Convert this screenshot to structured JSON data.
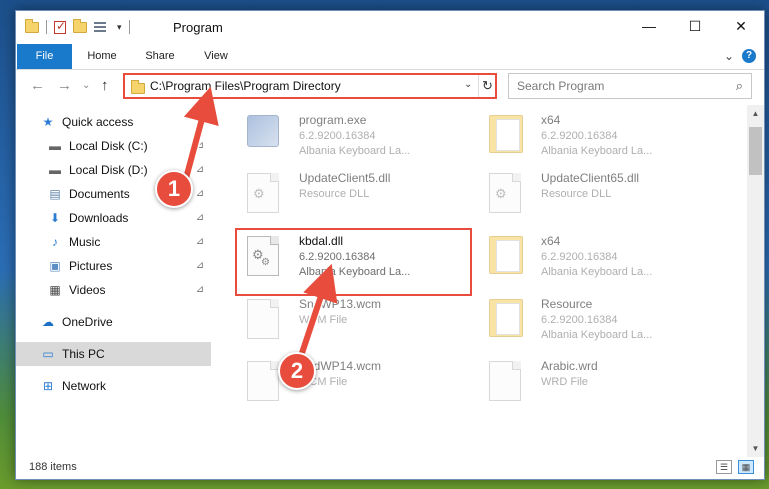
{
  "window": {
    "title": "Program",
    "minimize_label": "—",
    "maximize_label": "☐",
    "close_label": "✕"
  },
  "ribbon": {
    "tabs": [
      "File",
      "Home",
      "Share",
      "View"
    ],
    "expand_label": "⌄",
    "help_label": "?"
  },
  "address": {
    "path": "C:\\Program Files\\Program Directory",
    "dropdown_label": "⌄",
    "refresh_label": "↻"
  },
  "search": {
    "placeholder": "Search Program",
    "icon_label": "⌕"
  },
  "nav": {
    "back_label": "←",
    "forward_label": "→",
    "recent_label": "⌄",
    "up_label": "↑",
    "items": [
      {
        "label": "Quick access",
        "icon": "star-icon"
      },
      {
        "label": "Local Disk (C:)",
        "icon": "drive-icon",
        "pinned": true
      },
      {
        "label": "Local Disk (D:)",
        "icon": "drive-icon",
        "pinned": true
      },
      {
        "label": "Documents",
        "icon": "documents-icon",
        "pinned": true
      },
      {
        "label": "Downloads",
        "icon": "download-icon",
        "pinned": true
      },
      {
        "label": "Music",
        "icon": "music-icon",
        "pinned": true
      },
      {
        "label": "Pictures",
        "icon": "pictures-icon",
        "pinned": true
      },
      {
        "label": "Videos",
        "icon": "videos-icon",
        "pinned": true
      },
      {
        "label": "OneDrive",
        "icon": "cloud-icon"
      },
      {
        "label": "This PC",
        "icon": "computer-icon",
        "selected": true
      },
      {
        "label": "Network",
        "icon": "network-icon"
      }
    ],
    "pin_glyph": "📌"
  },
  "files": [
    {
      "name": "program.exe",
      "line1": "6.2.9200.16384",
      "line2": "Albania Keyboard La...",
      "icon": "exe-icon"
    },
    {
      "name": "x64",
      "line1": "6.2.9200.16384",
      "line2": "Albania Keyboard La...",
      "icon": "folder-icon"
    },
    {
      "name": "UpdateClient5.dll",
      "line1": "Resource DLL",
      "line2": "",
      "icon": "dll-icon"
    },
    {
      "name": "UpdateClient65.dll",
      "line1": "Resource DLL",
      "line2": "",
      "icon": "dll-icon"
    },
    {
      "name": "kbdal.dll",
      "line1": "6.2.9200.16384",
      "line2": "Albania Keyboard La...",
      "icon": "dll-icon",
      "highlighted": true
    },
    {
      "name": "x64",
      "line1": "6.2.9200.16384",
      "line2": "Albania Keyboard La...",
      "icon": "folder-icon"
    },
    {
      "name": "SndWP13.wcm",
      "line1": "WCM File",
      "line2": "",
      "icon": "file-icon"
    },
    {
      "name": "Resource",
      "line1": "6.2.9200.16384",
      "line2": "Albania Keyboard La...",
      "icon": "folder-icon"
    },
    {
      "name": "SndWP14.wcm",
      "line1": "WCM File",
      "line2": "",
      "icon": "file-icon"
    },
    {
      "name": "Arabic.wrd",
      "line1": "WRD File",
      "line2": "",
      "icon": "file-icon"
    }
  ],
  "status": {
    "item_count": "188 items"
  },
  "annotations": {
    "badge_1": "1",
    "badge_2": "2"
  },
  "colors": {
    "accent": "#1979ca",
    "highlight": "#e74c3c",
    "selected_nav": "#cce8ff"
  }
}
